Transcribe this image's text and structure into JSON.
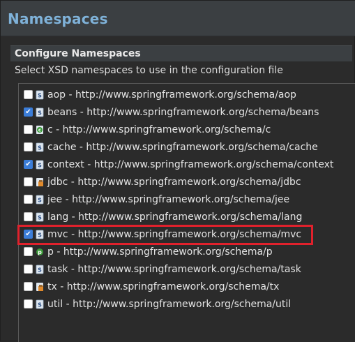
{
  "dialog": {
    "title": "Namespaces",
    "section_title": "Configure Namespaces",
    "description": "Select XSD namespaces to use in the configuration file"
  },
  "namespaces": [
    {
      "label": "aop - http://www.springframework.org/schema/aop",
      "checked": false,
      "icon": "xsd-file-icon"
    },
    {
      "label": "beans - http://www.springframework.org/schema/beans",
      "checked": true,
      "icon": "xsd-file-icon"
    },
    {
      "label": "c - http://www.springframework.org/schema/c",
      "checked": false,
      "icon": "c-namespace-icon"
    },
    {
      "label": "cache - http://www.springframework.org/schema/cache",
      "checked": false,
      "icon": "xsd-file-icon"
    },
    {
      "label": "context - http://www.springframework.org/schema/context",
      "checked": true,
      "icon": "xsd-file-icon"
    },
    {
      "label": "jdbc - http://www.springframework.org/schema/jdbc",
      "checked": false,
      "icon": "jdbc-icon"
    },
    {
      "label": "jee - http://www.springframework.org/schema/jee",
      "checked": false,
      "icon": "xsd-file-icon"
    },
    {
      "label": "lang - http://www.springframework.org/schema/lang",
      "checked": false,
      "icon": "xsd-file-icon"
    },
    {
      "label": "mvc - http://www.springframework.org/schema/mvc",
      "checked": true,
      "icon": "xsd-file-icon",
      "highlighted": true
    },
    {
      "label": "p - http://www.springframework.org/schema/p",
      "checked": false,
      "icon": "p-namespace-icon"
    },
    {
      "label": "task - http://www.springframework.org/schema/task",
      "checked": false,
      "icon": "xsd-file-icon"
    },
    {
      "label": "tx - http://www.springframework.org/schema/tx",
      "checked": false,
      "icon": "tx-icon"
    },
    {
      "label": "util - http://www.springframework.org/schema/util",
      "checked": false,
      "icon": "xsd-file-icon"
    }
  ],
  "colors": {
    "title": "#7fb2d9",
    "checkbox_checked": "#3b7dd8",
    "highlight": "#e0212c"
  }
}
